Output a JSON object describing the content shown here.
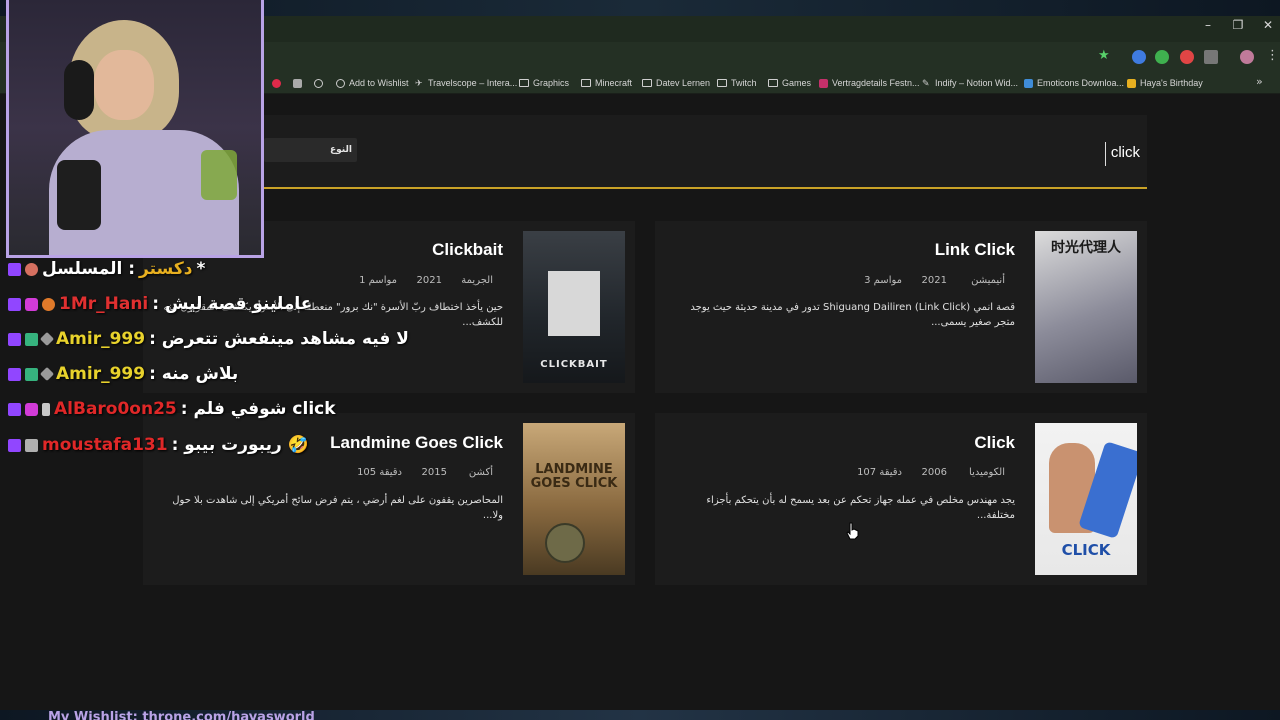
{
  "browser": {
    "window_controls": [
      "–",
      "❐",
      "✕"
    ],
    "bookmarks": [
      {
        "label": "",
        "icon": "pinterest-icon"
      },
      {
        "label": "",
        "icon": "app-icon"
      },
      {
        "label": "",
        "icon": "globe-icon"
      },
      {
        "label": "Add to Wishlist",
        "icon": "globe-icon"
      },
      {
        "label": "Travelscope – Intera...",
        "icon": "plane-icon"
      },
      {
        "label": "Graphics",
        "icon": "folder-icon"
      },
      {
        "label": "Minecraft",
        "icon": "folder-icon"
      },
      {
        "label": "Datev Lernen",
        "icon": "folder-icon"
      },
      {
        "label": "Twitch",
        "icon": "folder-icon"
      },
      {
        "label": "Games",
        "icon": "folder-icon"
      },
      {
        "label": "Vertragdetails Festn...",
        "icon": "site-icon"
      },
      {
        "label": "Indify – Notion Wid...",
        "icon": "pen-icon"
      },
      {
        "label": "Emoticons Downloa...",
        "icon": "site-icon"
      },
      {
        "label": "Haya's Birthday",
        "icon": "cake-icon"
      }
    ]
  },
  "search": {
    "value": "click",
    "type_label": "النوع"
  },
  "results": [
    {
      "title": "Link Click",
      "genre": "أنيميشن",
      "year": "2021",
      "length": "3 مواسم",
      "description": "قصة انمي (Shiguang Dailiren (Link Click تدور في مدينة حديثة حيث يوجد متجر صغير يسمى...",
      "poster_caption": "时光代理人"
    },
    {
      "title": "Clickbait",
      "genre": "الجريمة",
      "year": "2021",
      "length": "1 مواسم",
      "description": "حين يأخذ اختطاف ربّ الأسرة \"نك برور\" منعطفًا إلى الأسوأ، يكتشف المقرّبون منه للكشف...",
      "poster_caption": "CLICKBAIT"
    },
    {
      "title": "Click",
      "genre": "الكوميديا",
      "year": "2006",
      "length": "107 دقيقة",
      "description": "يجد مهندس مخلص في عمله جهاز تحكم عن بعد يسمح له بأن يتحكم بأجزاء مختلفة...",
      "poster_caption": "CLICK"
    },
    {
      "title": "Landmine Goes Click",
      "genre": "أكشن",
      "year": "2015",
      "length": "105 دقيقة",
      "description": "المحاصرين يقفون على لغم أرضي ، يتم فرض سائح أمريكي إلى شاهدت بلا حول ولا...",
      "poster_caption": "LANDMINE GOES CLICK"
    }
  ],
  "chat": [
    {
      "user": "دكستر",
      "user_color": "#e8b020",
      "message": "المسلسل :",
      "suffix": "*"
    },
    {
      "user": "1Mr_Hani",
      "user_color": "#e03030",
      "message": ": عاملينو قصة ليش"
    },
    {
      "user": "Amir_999",
      "user_color": "#e8d22c",
      "message": ": لا فيه مشاهد مينفعش تتعرض"
    },
    {
      "user": "Amir_999",
      "user_color": "#e8d22c",
      "message": ": بلاش منه"
    },
    {
      "user": "AlBaro0on25",
      "user_color": "#e02828",
      "message": ": شوفي فلم click"
    },
    {
      "user": "moustafa131",
      "user_color": "#e02828",
      "message": ": ريبورت بيبو 🤣"
    }
  ],
  "footer": "My Wishlist: throne.com/hayasworld"
}
